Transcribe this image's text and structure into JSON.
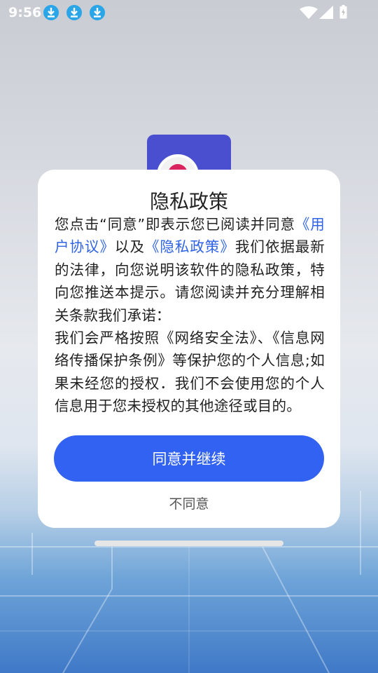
{
  "status_bar": {
    "time": "9:56",
    "notification_icons": [
      "download-icon",
      "download-icon",
      "download-icon"
    ],
    "accent": "#2aa5e8",
    "system_icons": [
      "wifi-icon",
      "signal-icon",
      "battery-charging-icon"
    ]
  },
  "dialog": {
    "title": "隐私政策",
    "body": {
      "p1_start": "您点击“同意”即表示您已阅读并同意",
      "user_agreement_link": "《用户协议》",
      "p1_mid": "以及",
      "privacy_policy_link": "《隐私政策》",
      "p1_end": "我们依据最新的法律，向您说明该软件的隐私政策，特向您推送本提示。请您阅读并充分理解相关条款我们承诺：",
      "p2": "我们会严格按照《网络安全法》、《信息网络传播保护条例》等保护您的个人信息;如果未经您的授权．我们不会使用您的个人信息用于您未授权的其他途径或目的。"
    },
    "agree_button": "同意并继续",
    "disagree_button": "不同意",
    "link_color": "#2f63e4",
    "button_color": "#3262f2"
  }
}
